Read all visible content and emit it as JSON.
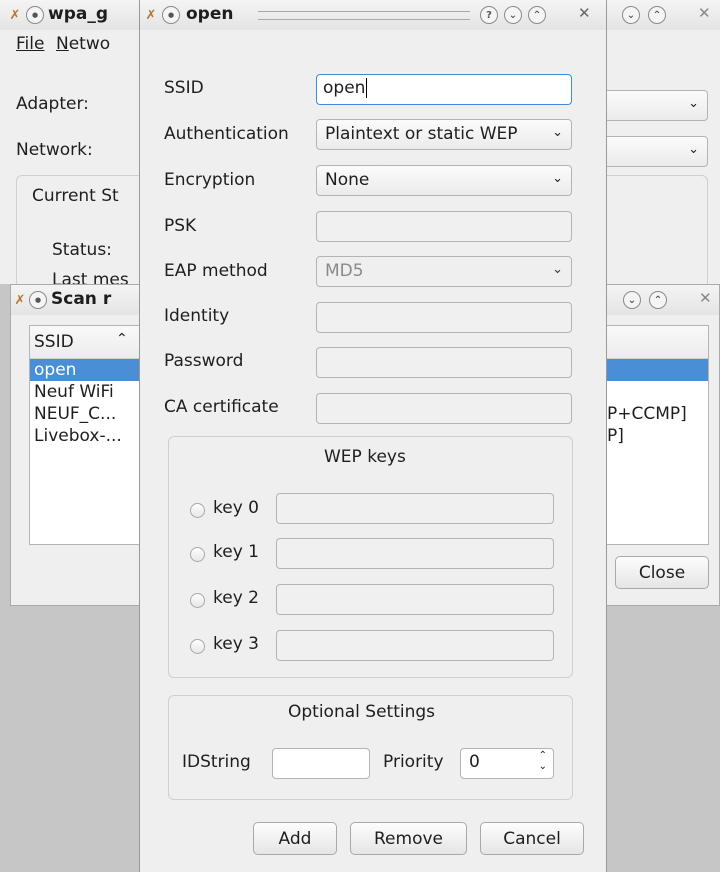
{
  "main_window": {
    "title": "wpa_g",
    "menu": {
      "file": "File",
      "file_rest": "ile",
      "network": "N",
      "network_rest": "etwo"
    },
    "adapter_label": "Adapter:",
    "network_label": "Network:",
    "current_status_label": "Current St",
    "status_label": "Status:",
    "last_message_label": "Last mes"
  },
  "scan_window": {
    "title": "Scan r",
    "column_ssid": "SSID",
    "rows": [
      {
        "ssid": "open",
        "right": ""
      },
      {
        "ssid": "Neuf WiFi",
        "right": ""
      },
      {
        "ssid": "NEUF_C...",
        "right": "IP+CCMP]"
      },
      {
        "ssid": "Livebox-...",
        "right": "IP]"
      }
    ],
    "close_label": "Close"
  },
  "dialog": {
    "title": "open",
    "ssid_label": "SSID",
    "ssid_value": "open",
    "auth_label": "Authentication",
    "auth_value": "Plaintext or static WEP",
    "encryption_label": "Encryption",
    "encryption_value": "None",
    "psk_label": "PSK",
    "eap_label": "EAP method",
    "eap_value": "MD5",
    "identity_label": "Identity",
    "password_label": "Password",
    "ca_label": "CA certificate",
    "wep_title": "WEP keys",
    "wep_keys": [
      "key 0",
      "key 1",
      "key 2",
      "key 3"
    ],
    "optional_title": "Optional Settings",
    "idstring_label": "IDString",
    "priority_label": "Priority",
    "priority_value": "0",
    "add_label": "Add",
    "remove_label": "Remove",
    "cancel_label": "Cancel"
  },
  "colors": {
    "accent": "#3b7fc8",
    "selection": "#4a8ed6",
    "background": "#c6c6c6"
  }
}
